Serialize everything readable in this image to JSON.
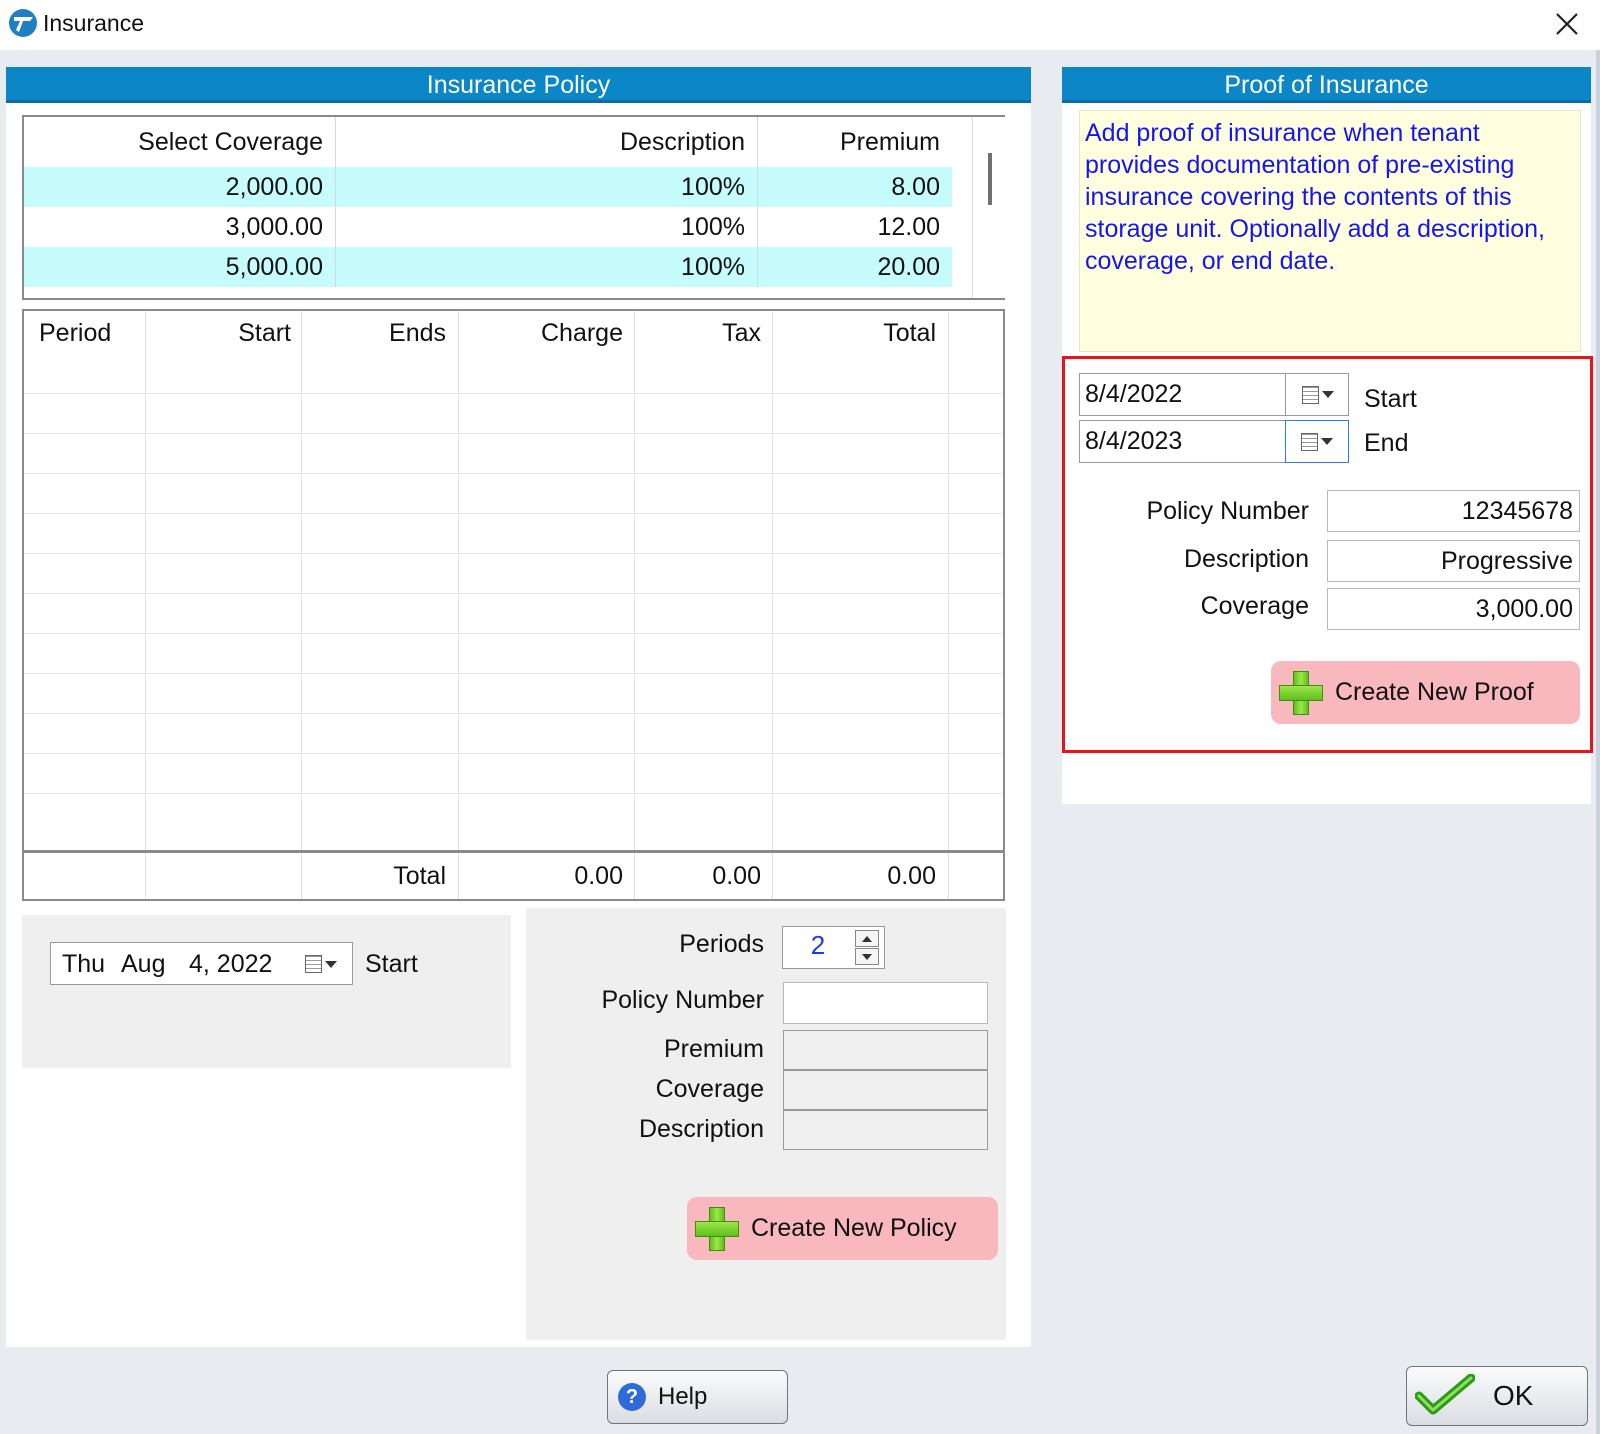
{
  "window": {
    "title": "Insurance",
    "close_glyph": "✕"
  },
  "insurance_policy": {
    "header": "Insurance Policy",
    "coverage_table": {
      "columns": [
        "Select Coverage",
        "Description",
        "Premium"
      ],
      "rows": [
        {
          "coverage": "2,000.00",
          "description": "100%",
          "premium": "8.00"
        },
        {
          "coverage": "3,000.00",
          "description": "100%",
          "premium": "12.00"
        },
        {
          "coverage": "5,000.00",
          "description": "100%",
          "premium": "20.00"
        }
      ]
    },
    "period_table": {
      "columns": [
        "Period",
        "Start",
        "Ends",
        "Charge",
        "Tax",
        "Total"
      ],
      "total_label": "Total",
      "totals": {
        "charge": "0.00",
        "tax": "0.00",
        "total": "0.00"
      }
    },
    "start_date": {
      "day": "Thu",
      "month": "Aug",
      "date": "4, 2022",
      "label": "Start"
    },
    "form": {
      "periods_label": "Periods",
      "periods_value": "2",
      "policy_number_label": "Policy Number",
      "policy_number_value": "",
      "premium_label": "Premium",
      "coverage_label": "Coverage",
      "description_label": "Description",
      "create_button": "Create New Policy"
    }
  },
  "proof_of_insurance": {
    "header": "Proof of Insurance",
    "note": "Add proof of insurance when tenant provides documentation of pre-existing insurance covering the contents of this storage unit.  Optionally add a description, coverage, or end date.",
    "start_date": "8/4/2022",
    "start_label": "Start",
    "end_date": "8/4/2023",
    "end_label": "End",
    "policy_number_label": "Policy Number",
    "policy_number_value": "12345678",
    "description_label": "Description",
    "description_value": "Progressive",
    "coverage_label": "Coverage",
    "coverage_value": "3,000.00",
    "create_button": "Create New Proof"
  },
  "footer": {
    "help_label": "Help",
    "help_icon_glyph": "?",
    "ok_label": "OK",
    "ok_icon_glyph": "✔"
  },
  "colors": {
    "header_blue": "#0b86c6",
    "row_highlight": "#c6fcfb",
    "note_text": "#1515f0",
    "note_background": "#ffffe0",
    "create_button": "#f8b8bd",
    "highlight_border": "#e8141c",
    "periods_value": "#1a3be0"
  },
  "icons": [
    "app-logo-icon",
    "close-icon",
    "calendar-icon",
    "dropdown-arrow-icon",
    "plus-icon",
    "help-icon",
    "checkmark-icon",
    "spin-up-icon",
    "spin-down-icon"
  ]
}
